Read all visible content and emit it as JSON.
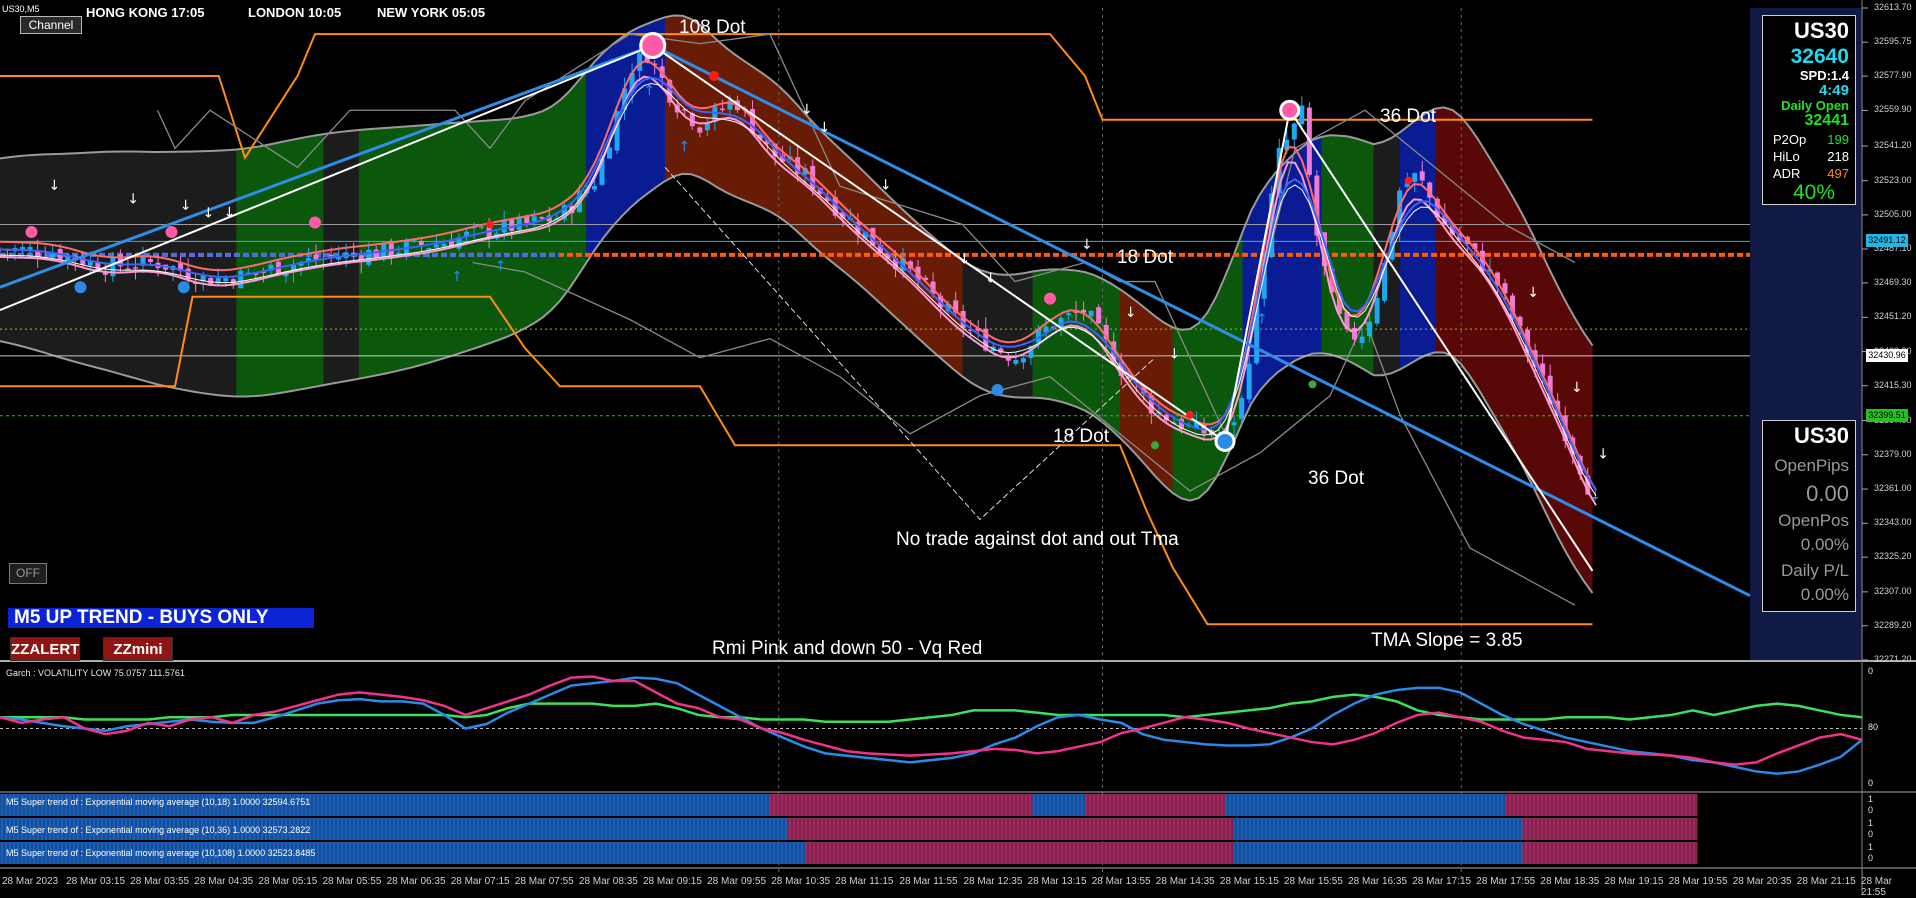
{
  "chart_data": {
    "type": "candlestick",
    "symbol": "US30,M5",
    "timeframe": "M5",
    "ylim": [
      32271.2,
      32613.7
    ],
    "price_ticks": [
      32613.7,
      32595.75,
      32577.9,
      32559.9,
      32541.2,
      32523.0,
      32505.0,
      32487.1,
      32469.3,
      32451.2,
      32433.2,
      32415.3,
      32397.0,
      32379.0,
      32361.0,
      32343.0,
      32325.2,
      32307.0,
      32289.2,
      32271.2
    ],
    "price_tick_labels": [
      "32613.70",
      "32595.75",
      "32577.90",
      "32559.90",
      "32541.20",
      "32523.00",
      "32505.00",
      "32487.10",
      "32469.30",
      "32451.20",
      "32433.20",
      "32415.30",
      "32397.00",
      "32379.00",
      "32361.00",
      "32343.00",
      "32325.20",
      "32307.00",
      "32289.20",
      "32271.20"
    ],
    "price_tags": [
      {
        "label": "32491.12",
        "value": 32491.12,
        "color": "#21b8e8"
      },
      {
        "label": "32430.96",
        "value": 32430.96,
        "color": "#ffffff"
      },
      {
        "label": "32399.51",
        "value": 32399.51,
        "color": "#22c322"
      }
    ],
    "time_labels": [
      "28 Mar 2023",
      "28 Mar 03:15",
      "28 Mar 03:55",
      "28 Mar 04:35",
      "28 Mar 05:15",
      "28 Mar 05:55",
      "28 Mar 06:35",
      "28 Mar 07:15",
      "28 Mar 07:55",
      "28 Mar 08:35",
      "28 Mar 09:15",
      "28 Mar 09:55",
      "28 Mar 10:35",
      "28 Mar 11:15",
      "28 Mar 11:55",
      "28 Mar 12:35",
      "28 Mar 13:15",
      "28 Mar 13:55",
      "28 Mar 14:35",
      "28 Mar 15:15",
      "28 Mar 15:55",
      "28 Mar 16:35",
      "28 Mar 17:15",
      "28 Mar 17:55",
      "28 Mar 18:35",
      "28 Mar 19:15",
      "28 Mar 19:55",
      "28 Mar 20:35",
      "28 Mar 21:15",
      "28 Mar 21:55"
    ],
    "close_path": [
      [
        0,
        32487
      ],
      [
        0.03,
        32486
      ],
      [
        0.06,
        32478
      ],
      [
        0.09,
        32480
      ],
      [
        0.12,
        32471
      ],
      [
        0.14,
        32473
      ],
      [
        0.16,
        32478
      ],
      [
        0.19,
        32483
      ],
      [
        0.22,
        32486
      ],
      [
        0.25,
        32490
      ],
      [
        0.28,
        32497
      ],
      [
        0.3,
        32500
      ],
      [
        0.32,
        32504
      ],
      [
        0.34,
        32523
      ],
      [
        0.35,
        32550
      ],
      [
        0.36,
        32582
      ],
      [
        0.37,
        32590
      ],
      [
        0.385,
        32565
      ],
      [
        0.4,
        32552
      ],
      [
        0.42,
        32566
      ],
      [
        0.44,
        32538
      ],
      [
        0.46,
        32526
      ],
      [
        0.48,
        32507
      ],
      [
        0.5,
        32490
      ],
      [
        0.52,
        32475
      ],
      [
        0.54,
        32455
      ],
      [
        0.56,
        32440
      ],
      [
        0.58,
        32430
      ],
      [
        0.6,
        32447
      ],
      [
        0.62,
        32455
      ],
      [
        0.64,
        32425
      ],
      [
        0.66,
        32402
      ],
      [
        0.68,
        32393
      ],
      [
        0.7,
        32388
      ],
      [
        0.71,
        32408
      ],
      [
        0.72,
        32470
      ],
      [
        0.73,
        32535
      ],
      [
        0.745,
        32560
      ],
      [
        0.75,
        32505
      ],
      [
        0.76,
        32462
      ],
      [
        0.77,
        32440
      ],
      [
        0.78,
        32444
      ],
      [
        0.79,
        32473
      ],
      [
        0.8,
        32519
      ],
      [
        0.81,
        32526
      ],
      [
        0.825,
        32500
      ],
      [
        0.84,
        32487
      ],
      [
        0.855,
        32470
      ],
      [
        0.87,
        32440
      ],
      [
        0.885,
        32410
      ],
      [
        0.9,
        32380
      ],
      [
        0.915,
        32345
      ]
    ],
    "annotations": [
      "108 Dot",
      "36 Dot",
      "18 Dot",
      "18 Dot",
      "36 Dot",
      "No trade against dot and out Tma",
      "Rmi Pink and down 50 - Vq Red",
      "TMA Slope = 3.85"
    ],
    "oscillator": {
      "title": "Garch : VOLATILITY LOW 75.0757 111.5761",
      "ylim": [
        0,
        100
      ],
      "ticks": [
        "0",
        "80",
        "0"
      ],
      "pink": [
        60,
        55,
        58,
        60,
        50,
        45,
        48,
        55,
        52,
        58,
        60,
        55,
        62,
        65,
        70,
        75,
        80,
        82,
        80,
        78,
        75,
        70,
        62,
        68,
        74,
        80,
        88,
        95,
        96,
        92,
        92,
        82,
        72,
        68,
        60,
        58,
        50,
        46,
        40,
        35,
        30,
        28,
        27,
        26,
        27,
        28,
        30,
        32,
        31,
        28,
        30,
        34,
        38,
        46,
        50,
        55,
        60,
        58,
        55,
        50,
        46,
        42,
        38,
        36,
        40,
        46,
        55,
        62,
        64,
        60,
        56,
        48,
        42,
        40,
        38,
        32,
        30,
        28,
        27,
        26,
        24,
        20,
        18,
        20,
        28,
        35,
        42,
        45,
        40
      ],
      "blue": [
        60,
        58,
        55,
        52,
        50,
        48,
        52,
        54,
        56,
        58,
        56,
        55,
        55,
        60,
        66,
        72,
        75,
        76,
        74,
        74,
        72,
        62,
        50,
        54,
        64,
        72,
        80,
        88,
        90,
        92,
        95,
        94,
        90,
        80,
        70,
        60,
        50,
        42,
        34,
        28,
        26,
        24,
        22,
        20,
        22,
        24,
        28,
        36,
        42,
        52,
        60,
        62,
        58,
        55,
        45,
        40,
        38,
        36,
        35,
        35,
        36,
        42,
        50,
        62,
        72,
        80,
        84,
        86,
        86,
        82,
        72,
        62,
        54,
        48,
        42,
        38,
        34,
        30,
        28,
        26,
        22,
        20,
        16,
        12,
        10,
        12,
        18,
        25,
        40
      ],
      "green": [
        60,
        60,
        60,
        60,
        58,
        58,
        58,
        58,
        60,
        60,
        60,
        62,
        62,
        62,
        62,
        62,
        62,
        62,
        62,
        62,
        62,
        62,
        60,
        62,
        68,
        72,
        72,
        72,
        72,
        70,
        70,
        72,
        68,
        62,
        60,
        60,
        58,
        58,
        58,
        56,
        56,
        56,
        56,
        58,
        60,
        62,
        66,
        66,
        66,
        64,
        62,
        62,
        62,
        62,
        62,
        62,
        60,
        62,
        64,
        66,
        68,
        72,
        74,
        78,
        80,
        78,
        74,
        66,
        62,
        60,
        58,
        58,
        58,
        58,
        60,
        60,
        60,
        58,
        60,
        62,
        66,
        62,
        66,
        70,
        72,
        70,
        66,
        62,
        60
      ]
    },
    "supertrend_rows": [
      {
        "label": "M5  Super trend of : Exponential moving average (10,18)  1.0000 32594.6751",
        "segments": [
          [
            0,
            0.44,
            "blue"
          ],
          [
            0.44,
            0.59,
            "pink"
          ],
          [
            0.59,
            0.62,
            "blue"
          ],
          [
            0.62,
            0.7,
            "pink"
          ],
          [
            0.7,
            0.86,
            "blue"
          ],
          [
            0.86,
            0.97,
            "pink"
          ]
        ]
      },
      {
        "label": "M5  Super trend of : Exponential moving average (10,36)  1.0000 32573.2822",
        "segments": [
          [
            0,
            0.45,
            "blue"
          ],
          [
            0.45,
            0.705,
            "pink"
          ],
          [
            0.705,
            0.87,
            "blue"
          ],
          [
            0.87,
            0.97,
            "pink"
          ]
        ]
      },
      {
        "label": "M5  Super trend of : Exponential moving average (10,108)  1.0000 32523.8485",
        "segments": [
          [
            0,
            0.46,
            "blue"
          ],
          [
            0.46,
            0.705,
            "pink"
          ],
          [
            0.705,
            0.87,
            "blue"
          ],
          [
            0.87,
            0.97,
            "pink"
          ]
        ]
      }
    ],
    "colors": {
      "bull": "#1fa8f0",
      "bear": "#f07ad6",
      "tma_up": "#0b1d9c",
      "tma_down": "#6e1d06",
      "band_green": "#0c5c0c",
      "band_red": "#5e0808",
      "band_gray": "#1d1d1d",
      "trendline": "#2e8de8",
      "orange": "#ff8c12",
      "pink_line": "#f2328a",
      "blue_line": "#2a8ae6",
      "green_line": "#3ee05a"
    }
  },
  "header": {
    "symbol": "US30,M5",
    "channel_button": "Channel",
    "sessions": [
      {
        "label": "HONG KONG  17:05",
        "color": "#a81212"
      },
      {
        "label": "LONDON  10:05",
        "color": "#1872d8"
      },
      {
        "label": "NEW YORK  05:05",
        "color": "#a81212"
      }
    ]
  },
  "info_panel": {
    "symbol": "US30",
    "price": "32640",
    "spread": "SPD:1.4",
    "timer": "4:49",
    "daily_open_label": "Daily Open",
    "daily_open": "32441",
    "rows": [
      {
        "label": "P2Op",
        "value": "199",
        "color": "#22e022"
      },
      {
        "label": "HiLo",
        "value": "218",
        "color": "#ffffff"
      },
      {
        "label": "ADR",
        "value": "497",
        "color": "#ff8c12"
      }
    ],
    "percent": "40%"
  },
  "trade_panel": {
    "symbol": "US30",
    "open_pips_label": "OpenPips",
    "open_pips": "0.00",
    "open_pos_label": "OpenPos",
    "open_pos": "0.00%",
    "daily_pl_label": "Daily P/L",
    "daily_pl": "0.00%"
  },
  "controls": {
    "off_button": "OFF",
    "trend_banner": "M5 UP TREND - BUYS ONLY",
    "zzalert": "ZZALERT",
    "zzmini": "ZZmini"
  },
  "annotations": {
    "dot108": "108 Dot",
    "dot36_top": "36 Dot",
    "dot18_top": "18 Dot",
    "dot18_bottom": "18 Dot",
    "dot36_bottom": "36 Dot",
    "no_trade": "No trade against dot and out Tma",
    "rmi": "Rmi Pink and down 50 - Vq Red",
    "tma_slope": "TMA Slope = 3.85"
  }
}
